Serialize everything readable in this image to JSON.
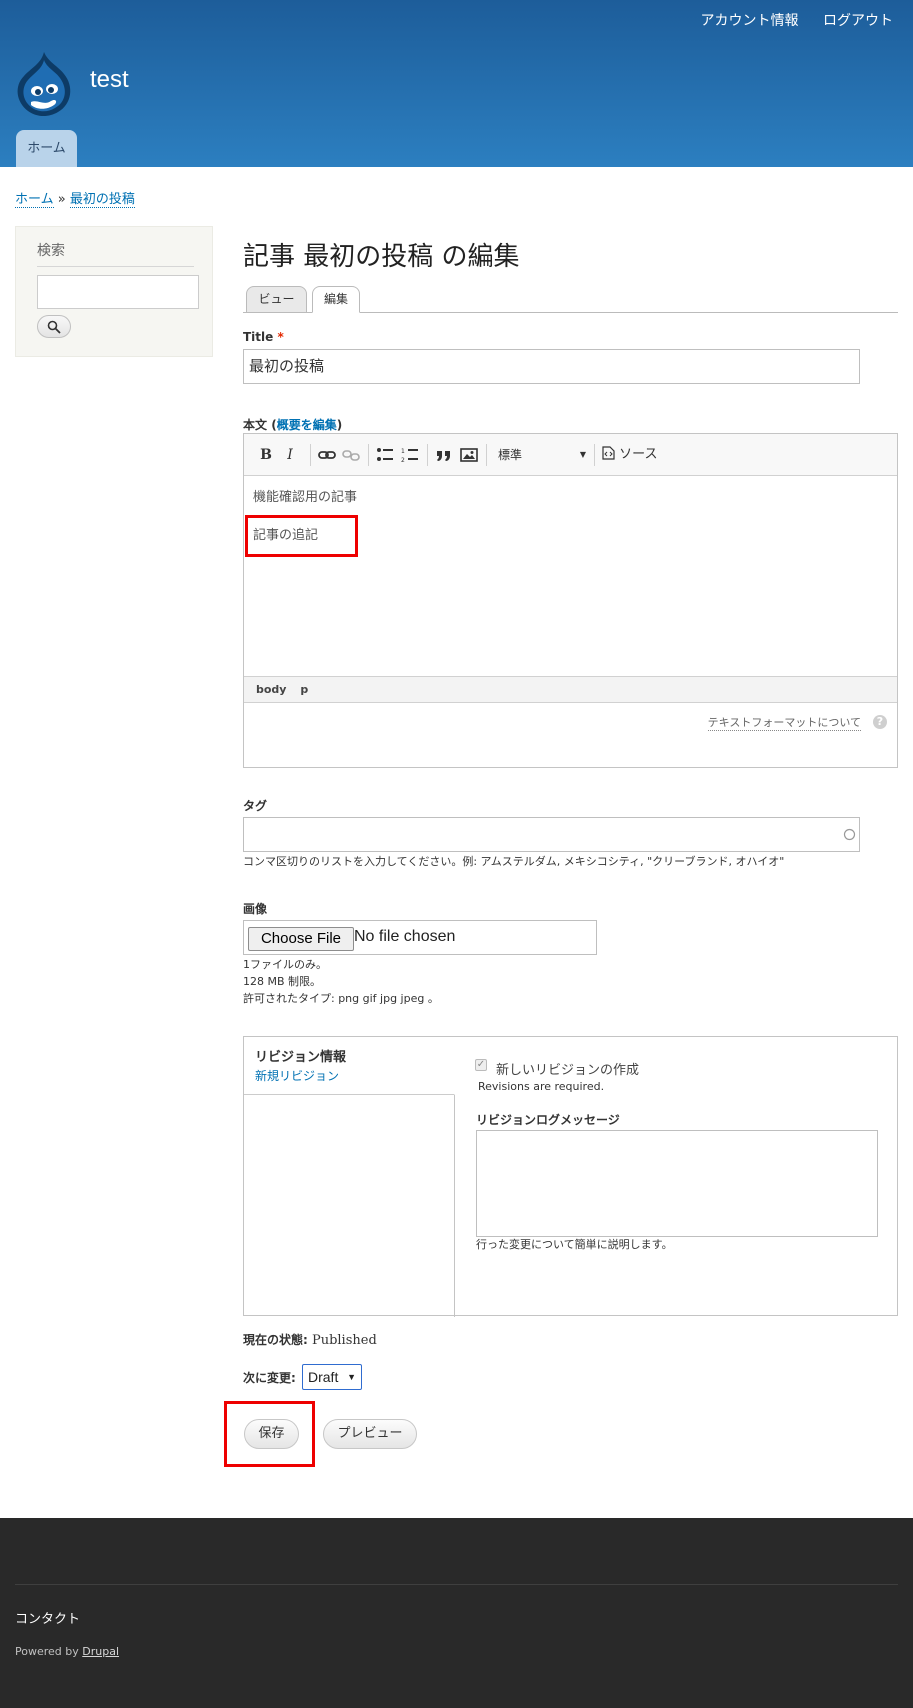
{
  "header": {
    "site_name": "test",
    "secondary_menu": [
      "アカウント情報",
      "ログアウト"
    ],
    "main_menu": [
      "ホーム"
    ]
  },
  "breadcrumb": {
    "home": "ホーム",
    "separator": "»",
    "current": "最初の投稿"
  },
  "sidebar": {
    "search_title": "検索",
    "search_value": ""
  },
  "page": {
    "title": "記事 最初の投稿 の編集",
    "tabs": [
      "ビュー",
      "編集"
    ]
  },
  "form": {
    "title_label": "Title",
    "title_required": "*",
    "title_value": "最初の投稿",
    "body_label": "本文",
    "body_summary_link": "概要を編集",
    "body_paren_open": "(",
    "body_paren_close": ")",
    "toolbar": {
      "bold": "B",
      "italic": "I",
      "format_select": "標準",
      "source": "ソース"
    },
    "body_lines": [
      "機能確認用の記事",
      "記事の追記"
    ],
    "body_path": [
      "body",
      "p"
    ],
    "format_help": "テキストフォーマットについて",
    "help_icon_text": "?",
    "tags_label": "タグ",
    "tags_value": "",
    "tags_description": "コンマ区切りのリストを入力してください。例: アムステルダム, メキシコシティ, \"クリーブランド, オハイオ\"",
    "image_label": "画像",
    "choose_file": "Choose File",
    "no_file": "No file chosen",
    "image_desc": [
      "1ファイルのみ。",
      "128 MB 制限。",
      "許可されたタイプ: png gif jpg jpeg 。"
    ],
    "revision": {
      "tab_title": "リビジョン情報",
      "tab_summary": "新規リビジョン",
      "checkbox_label": "新しいリビジョンの作成",
      "checkbox_checked": true,
      "required_note": "Revisions are required.",
      "log_label": "リビジョンログメッセージ",
      "log_value": "",
      "log_desc": "行った変更について簡単に説明します。"
    },
    "state_label": "現在の状態:",
    "state_value": "Published",
    "change_label": "次に変更:",
    "change_value": "Draft",
    "save": "保存",
    "preview": "プレビュー"
  },
  "footer": {
    "contact": "コンタクト",
    "powered_by": "Powered by",
    "drupal": "Drupal"
  },
  "colors": {
    "header_top": "#1d5d9a",
    "header_bottom": "#2c7fc0",
    "link": "#0071b3",
    "highlight": "#ee0000",
    "footer": "#292929"
  }
}
